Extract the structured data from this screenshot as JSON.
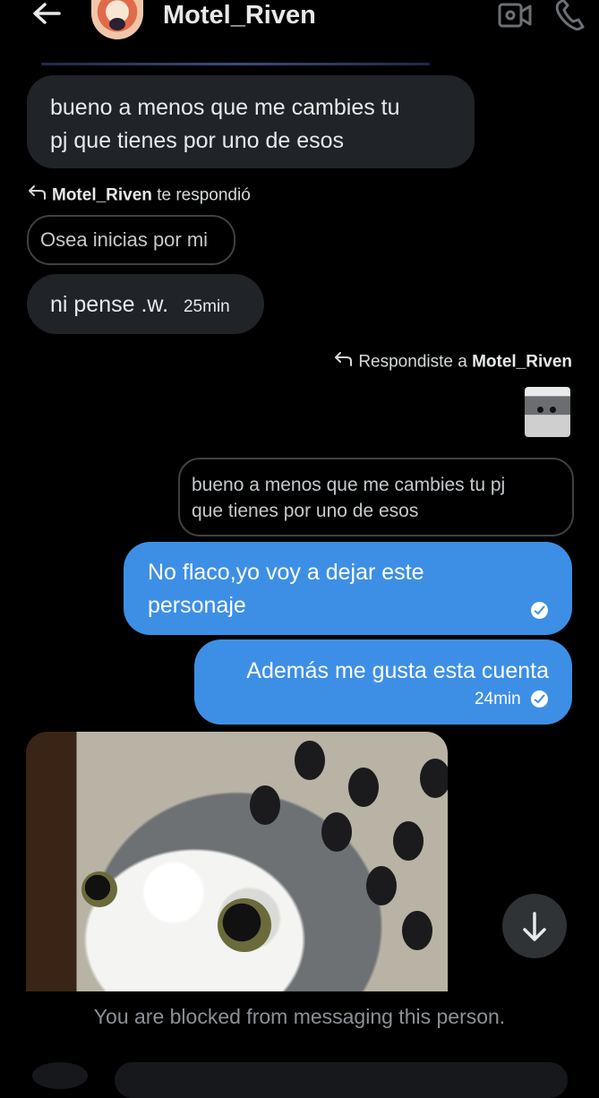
{
  "header": {
    "title": "Motel_Riven",
    "icons": [
      "back-arrow-icon",
      "avatar",
      "video-call-icon",
      "phone-call-icon"
    ]
  },
  "messages": {
    "incoming1": {
      "lines": [
        "bueno a menos que me cambies tu",
        "pj que tienes por uno de esos"
      ]
    },
    "reply_label1": {
      "name": "Motel_Riven",
      "suffix": " te respondió"
    },
    "quote1": {
      "text": "Osea inicias por mi"
    },
    "incoming2": {
      "text": "ni pense .w.",
      "time": "25min"
    },
    "reply_label2": {
      "prefix": "Respondiste a ",
      "name": "Motel_Riven"
    },
    "quote2": {
      "lines": [
        "bueno a menos que me cambies tu pj",
        "que tienes por uno de esos"
      ]
    },
    "outgoing1": {
      "lines": [
        "No flaco,yo voy a dejar este",
        "personaje"
      ]
    },
    "outgoing2": {
      "text": "Además me gusta esta cuenta",
      "time": "24min"
    }
  },
  "footer": {
    "blocked_text": "You are blocked from messaging this person."
  },
  "colors": {
    "background": "#000000",
    "incoming_bubble": "#202327",
    "outgoing_bubble": "#3d8fe6",
    "muted_text": "#8b9196"
  }
}
